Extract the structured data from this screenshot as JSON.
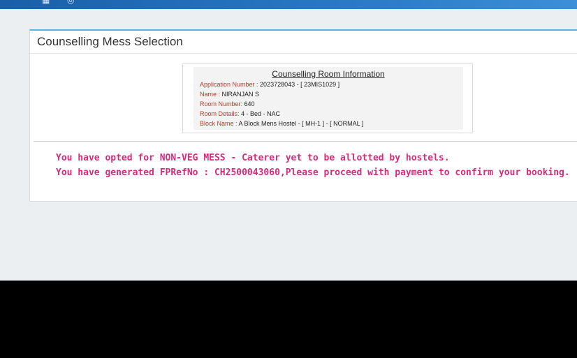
{
  "topbar": {
    "icons": [
      "grid-icon",
      "settings-icon"
    ]
  },
  "card": {
    "title": "Counselling Mess Selection"
  },
  "room_info": {
    "heading": "Counselling Room Information",
    "rows": [
      {
        "label": "Application Number :",
        "value": " 2023728043 - [ 23MIS1029 ]"
      },
      {
        "label": "Name :",
        "value": " NIRANJAN S"
      },
      {
        "label": "Room Number:",
        "value": " 640"
      },
      {
        "label": "Room Details:",
        "value": " 4 - Bed - NAC"
      },
      {
        "label": "Block Name :",
        "value": " A Block Mens Hostel - [ MH-1 ] - [ NORMAL ]"
      }
    ]
  },
  "messages": [
    "You have opted for NON-VEG MESS - Caterer yet to be allotted by hostels.",
    "You have generated FPRefNo : CH2500043060,Please proceed with payment to confirm your booking."
  ],
  "colors": {
    "topbar": "#2a78c6",
    "card_accent": "#5bb3e0",
    "label_red": "#c0392b",
    "message_pink": "#d62b7a"
  }
}
